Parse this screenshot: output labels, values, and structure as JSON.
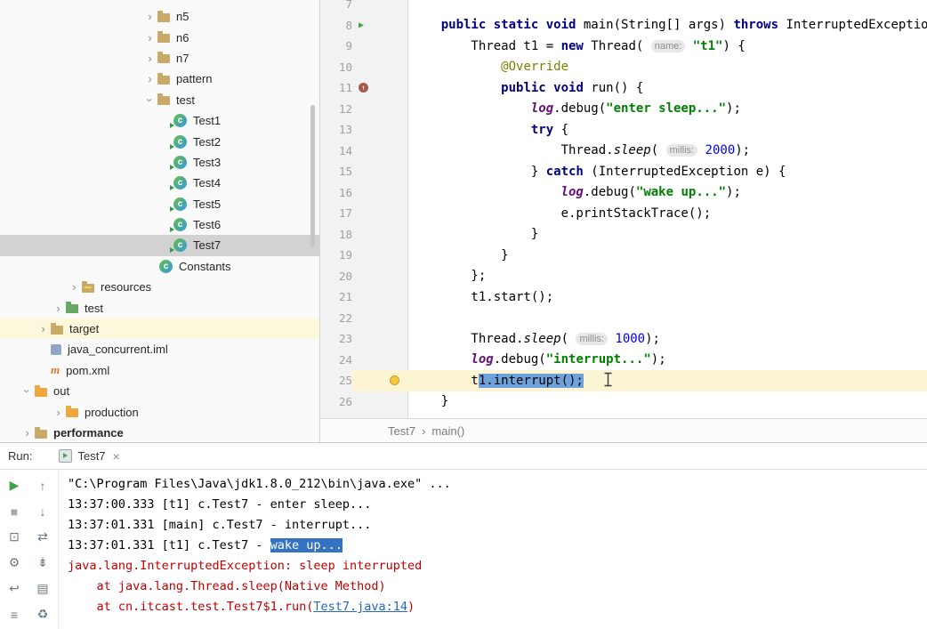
{
  "palette": {
    "keyword": "#000080",
    "string": "#008000",
    "number": "#0000ff",
    "annotation": "#808000",
    "static_field": "#660e7a",
    "editor_selection": "#6da2dd",
    "console_selection": "#3573c2",
    "error_text": "#c00000",
    "link": "#2768b7",
    "current_line": "#fcf5d3",
    "tree_selected_row": "#d2d2d2",
    "tree_highlight_row": "#fdf7dc",
    "run_green": "#3fa34c"
  },
  "project_tree": {
    "items": [
      {
        "label": "n5",
        "icon": "folder",
        "chevron": "right",
        "indent": 160
      },
      {
        "label": "n6",
        "icon": "folder",
        "chevron": "right",
        "indent": 160
      },
      {
        "label": "n7",
        "icon": "folder",
        "chevron": "right",
        "indent": 160
      },
      {
        "label": "pattern",
        "icon": "folder",
        "chevron": "right",
        "indent": 160
      },
      {
        "label": "test",
        "icon": "folder",
        "chevron": "down",
        "indent": 160
      },
      {
        "label": "Test1",
        "icon": "class-run",
        "chevron": "none",
        "indent": 178
      },
      {
        "label": "Test2",
        "icon": "class-run",
        "chevron": "none",
        "indent": 178
      },
      {
        "label": "Test3",
        "icon": "class-run",
        "chevron": "none",
        "indent": 178
      },
      {
        "label": "Test4",
        "icon": "class-run",
        "chevron": "none",
        "indent": 178
      },
      {
        "label": "Test5",
        "icon": "class-run",
        "chevron": "none",
        "indent": 178
      },
      {
        "label": "Test6",
        "icon": "class-run",
        "chevron": "none",
        "indent": 178
      },
      {
        "label": "Test7",
        "icon": "class-run",
        "chevron": "none",
        "indent": 178,
        "selected": true
      },
      {
        "label": "Constants",
        "icon": "class",
        "chevron": "none",
        "indent": 162
      },
      {
        "label": "resources",
        "icon": "folder-res",
        "chevron": "right",
        "indent": 75
      },
      {
        "label": "test",
        "icon": "folder-green",
        "chevron": "right",
        "indent": 57
      },
      {
        "label": "target",
        "icon": "folder",
        "chevron": "right",
        "indent": 40,
        "highlight": true
      },
      {
        "label": "java_concurrent.iml",
        "icon": "iml",
        "chevron": "none",
        "indent": 40
      },
      {
        "label": "pom.xml",
        "icon": "maven",
        "chevron": "none",
        "indent": 40
      },
      {
        "label": "out",
        "icon": "folder-orange",
        "chevron": "down",
        "indent": 22
      },
      {
        "label": "production",
        "icon": "folder-orange",
        "chevron": "right",
        "indent": 57
      },
      {
        "label": "performance",
        "icon": "folder",
        "chevron": "right",
        "indent": 22,
        "bold": true
      }
    ]
  },
  "editor": {
    "lines": [
      {
        "num": 7,
        "segments": []
      },
      {
        "num": 8,
        "gutter": "run",
        "segments": [
          {
            "t": "    "
          },
          {
            "t": "public static void ",
            "c": "kw"
          },
          {
            "t": "main(String[] args) "
          },
          {
            "t": "throws ",
            "c": "kw"
          },
          {
            "t": "InterruptedException {"
          }
        ]
      },
      {
        "num": 9,
        "segments": [
          {
            "t": "        Thread t1 = "
          },
          {
            "t": "new ",
            "c": "kw"
          },
          {
            "t": "Thread( "
          },
          {
            "t": "name:",
            "c": "hint"
          },
          {
            "t": " "
          },
          {
            "t": "\"t1\"",
            "c": "str"
          },
          {
            "t": ") {"
          }
        ]
      },
      {
        "num": 10,
        "segments": [
          {
            "t": "            "
          },
          {
            "t": "@Override",
            "c": "ann"
          }
        ]
      },
      {
        "num": 11,
        "gutter": "override",
        "segments": [
          {
            "t": "            "
          },
          {
            "t": "public void ",
            "c": "kw"
          },
          {
            "t": "run() {"
          }
        ]
      },
      {
        "num": 12,
        "segments": [
          {
            "t": "                "
          },
          {
            "t": "log",
            "c": "fld"
          },
          {
            "t": ".debug("
          },
          {
            "t": "\"enter sleep...\"",
            "c": "str"
          },
          {
            "t": ");"
          }
        ]
      },
      {
        "num": 13,
        "segments": [
          {
            "t": "                "
          },
          {
            "t": "try ",
            "c": "kw"
          },
          {
            "t": "{"
          }
        ]
      },
      {
        "num": 14,
        "segments": [
          {
            "t": "                    Thread."
          },
          {
            "t": "sleep",
            "c": "stm"
          },
          {
            "t": "( "
          },
          {
            "t": "millis:",
            "c": "hint"
          },
          {
            "t": " "
          },
          {
            "t": "2000",
            "c": "num"
          },
          {
            "t": ");"
          }
        ]
      },
      {
        "num": 15,
        "segments": [
          {
            "t": "                } "
          },
          {
            "t": "catch ",
            "c": "kw"
          },
          {
            "t": "(InterruptedException e) {"
          }
        ]
      },
      {
        "num": 16,
        "segments": [
          {
            "t": "                    "
          },
          {
            "t": "log",
            "c": "fld"
          },
          {
            "t": ".debug("
          },
          {
            "t": "\"wake up...\"",
            "c": "str"
          },
          {
            "t": ");"
          }
        ]
      },
      {
        "num": 17,
        "segments": [
          {
            "t": "                    e.printStackTrace();"
          }
        ]
      },
      {
        "num": 18,
        "segments": [
          {
            "t": "                }"
          }
        ]
      },
      {
        "num": 19,
        "segments": [
          {
            "t": "            }"
          }
        ]
      },
      {
        "num": 20,
        "segments": [
          {
            "t": "        };"
          }
        ]
      },
      {
        "num": 21,
        "segments": [
          {
            "t": "        t1.start();"
          }
        ]
      },
      {
        "num": 22,
        "segments": []
      },
      {
        "num": 23,
        "segments": [
          {
            "t": "        Thread."
          },
          {
            "t": "sleep",
            "c": "stm"
          },
          {
            "t": "( "
          },
          {
            "t": "millis:",
            "c": "hint"
          },
          {
            "t": " "
          },
          {
            "t": "1000",
            "c": "num"
          },
          {
            "t": ");"
          }
        ]
      },
      {
        "num": 24,
        "segments": [
          {
            "t": "        "
          },
          {
            "t": "log",
            "c": "fld"
          },
          {
            "t": ".debug("
          },
          {
            "t": "\"interrupt...\"",
            "c": "str"
          },
          {
            "t": ");"
          }
        ]
      },
      {
        "num": 25,
        "gutter": "bulb",
        "current": true,
        "segments": [
          {
            "t": "        t"
          },
          {
            "t": "1.interrupt();",
            "c": "sel"
          }
        ]
      },
      {
        "num": 26,
        "segments": [
          {
            "t": "    }"
          }
        ]
      }
    ],
    "breadcrumb": {
      "items": [
        "Test7",
        "main()"
      ],
      "separator": "›"
    }
  },
  "run_panel": {
    "label": "Run:",
    "tab_label": "Test7",
    "tab_close": "×",
    "toolbar": {
      "col1": [
        {
          "name": "rerun-button",
          "glyph": "▶",
          "cls": "green"
        },
        {
          "name": "stop-button",
          "glyph": "■",
          "cls": "dim"
        },
        {
          "name": "dump-threads-button",
          "glyph": "⊡",
          "cls": ""
        },
        {
          "name": "settings-button",
          "glyph": "⚙",
          "cls": ""
        },
        {
          "name": "attach-button",
          "glyph": "↩",
          "cls": ""
        },
        {
          "name": "options-menu-button",
          "glyph": "≡",
          "cls": ""
        }
      ],
      "col2": [
        {
          "name": "prev-stacktrace-button",
          "glyph": "↑",
          "cls": ""
        },
        {
          "name": "next-stacktrace-button",
          "glyph": "↓",
          "cls": ""
        },
        {
          "name": "soft-wrap-button",
          "glyph": "⇄",
          "cls": ""
        },
        {
          "name": "scroll-to-end-button",
          "glyph": "⇟",
          "cls": ""
        },
        {
          "name": "print-button",
          "glyph": "▤",
          "cls": ""
        },
        {
          "name": "clear-console-button",
          "glyph": "♻",
          "cls": ""
        }
      ]
    },
    "console_lines": [
      {
        "segments": [
          {
            "t": "\"C:\\Program Files\\Java\\jdk1.8.0_212\\bin\\java.exe\" ..."
          }
        ]
      },
      {
        "segments": [
          {
            "t": "13:37:00.333 [t1] c.Test7 - enter sleep..."
          }
        ]
      },
      {
        "segments": [
          {
            "t": "13:37:01.331 [main] c.Test7 - interrupt..."
          }
        ]
      },
      {
        "segments": [
          {
            "t": "13:37:01.331 [t1] c.Test7 - "
          },
          {
            "t": "wake up...",
            "c": "consel"
          }
        ]
      },
      {
        "segments": [
          {
            "t": "java.lang.InterruptedException: sleep interrupted",
            "c": "err"
          }
        ]
      },
      {
        "segments": [
          {
            "t": "    at java.lang.Thread.sleep(Native Method)",
            "c": "err"
          }
        ]
      },
      {
        "segments": [
          {
            "t": "    at cn.itcast.test.Test7$1.run(",
            "c": "err"
          },
          {
            "t": "Test7.java:14",
            "c": "link"
          },
          {
            "t": ")",
            "c": "err"
          }
        ]
      }
    ]
  }
}
